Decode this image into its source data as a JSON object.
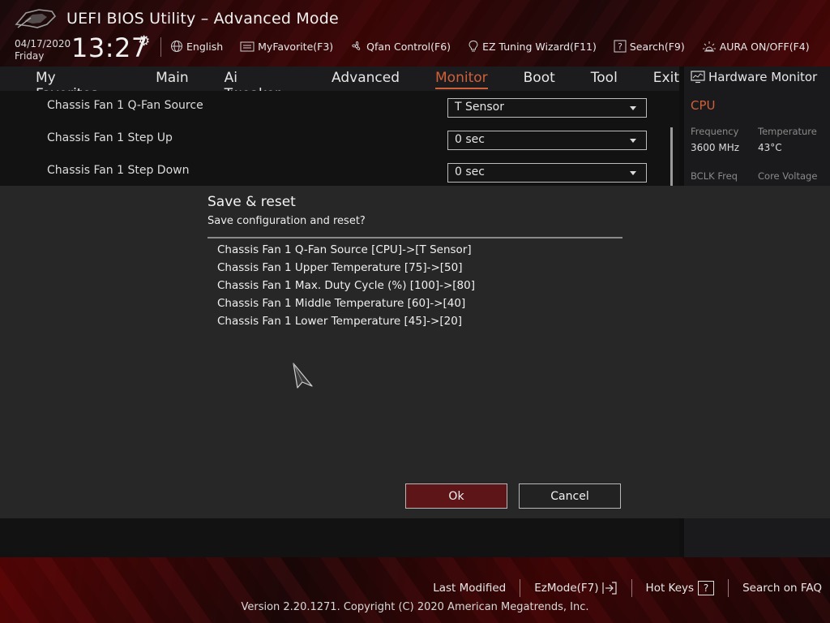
{
  "header": {
    "title": "UEFI BIOS Utility – Advanced Mode",
    "date": "04/17/2020",
    "day": "Friday",
    "time": "13:27",
    "toolbar": {
      "language": "English",
      "my_favorite": "MyFavorite(F3)",
      "qfan": "Qfan Control(F6)",
      "ez_tuning": "EZ Tuning Wizard(F11)",
      "search": "Search(F9)",
      "aura": "AURA ON/OFF(F4)"
    }
  },
  "nav": {
    "tabs": [
      "My Favorites",
      "Main",
      "Ai Tweaker",
      "Advanced",
      "Monitor",
      "Boot",
      "Tool",
      "Exit"
    ],
    "active": "Monitor"
  },
  "settings": [
    {
      "label": "Chassis Fan 1 Q-Fan Source",
      "value": "T Sensor"
    },
    {
      "label": "Chassis Fan 1 Step Up",
      "value": "0 sec"
    },
    {
      "label": "Chassis Fan 1 Step Down",
      "value": "0 sec"
    }
  ],
  "hardware_monitor": {
    "title": "Hardware Monitor",
    "section": "CPU",
    "frequency_label": "Frequency",
    "frequency_value": "3600 MHz",
    "temperature_label": "Temperature",
    "temperature_value": "43°C",
    "bclk_label": "BCLK Freq",
    "core_voltage_label": "Core Voltage"
  },
  "dialog": {
    "title": "Save & reset",
    "subtitle": "Save configuration and reset?",
    "changes": [
      "Chassis Fan 1 Q-Fan Source [CPU]->[T Sensor]",
      "Chassis Fan 1 Upper Temperature [75]->[50]",
      "Chassis Fan 1 Max. Duty Cycle (%) [100]->[80]",
      "Chassis Fan 1 Middle Temperature [60]->[40]",
      "Chassis Fan 1 Lower Temperature [45]->[20]"
    ],
    "ok_label": "Ok",
    "cancel_label": "Cancel"
  },
  "footer": {
    "last_modified": "Last Modified",
    "ez_mode": "EzMode(F7)",
    "hot_keys": "Hot Keys",
    "hot_keys_glyph": "?",
    "search_faq": "Search on FAQ",
    "copyright": "Version 2.20.1271. Copyright (C) 2020 American Megatrends, Inc."
  },
  "colors": {
    "accent": "#d0603a",
    "ok_button": "#5e1517",
    "dialog_bg": "#272728"
  }
}
